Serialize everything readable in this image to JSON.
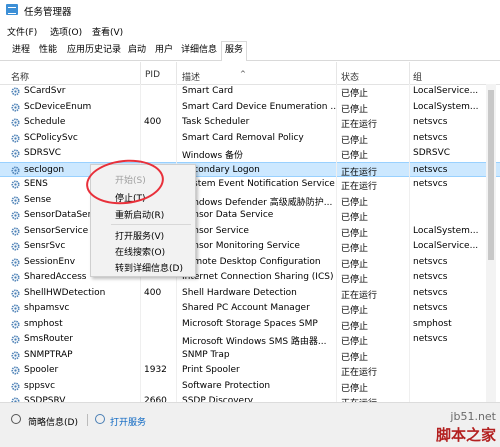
{
  "window": {
    "title": "任务管理器"
  },
  "menu": [
    "文件(F)",
    "选项(O)",
    "查看(V)"
  ],
  "tabs": [
    "进程",
    "性能",
    "应用历史记录",
    "启动",
    "用户",
    "详细信息",
    "服务"
  ],
  "active_tab": "服务",
  "columns": {
    "name": "名称",
    "pid": "PID",
    "desc": "描述",
    "status": "状态",
    "group": "组"
  },
  "services": [
    {
      "name": "SCardSvr",
      "pid": "",
      "desc": "Smart Card",
      "status": "已停止",
      "group": "LocalService..."
    },
    {
      "name": "ScDeviceEnum",
      "pid": "",
      "desc": "Smart Card Device Enumeration ...",
      "status": "已停止",
      "group": "LocalSystem..."
    },
    {
      "name": "Schedule",
      "pid": "400",
      "desc": "Task Scheduler",
      "status": "正在运行",
      "group": "netsvcs"
    },
    {
      "name": "SCPolicySvc",
      "pid": "",
      "desc": "Smart Card Removal Policy",
      "status": "已停止",
      "group": "netsvcs"
    },
    {
      "name": "SDRSVC",
      "pid": "",
      "desc": "Windows 备份",
      "status": "已停止",
      "group": "SDRSVC"
    },
    {
      "name": "seclogon",
      "pid": "",
      "desc": "Secondary Logon",
      "status": "正在运行",
      "group": "netsvcs"
    },
    {
      "name": "SENS",
      "pid": "",
      "desc": "System Event Notification Service",
      "status": "正在运行",
      "group": "netsvcs"
    },
    {
      "name": "Sense",
      "pid": "",
      "desc": "Windows Defender 高级威胁防护...",
      "status": "已停止",
      "group": ""
    },
    {
      "name": "SensorDataService",
      "pid": "",
      "desc": "Sensor Data Service",
      "status": "已停止",
      "group": ""
    },
    {
      "name": "SensorService",
      "pid": "",
      "desc": "Sensor Service",
      "status": "已停止",
      "group": "LocalSystem..."
    },
    {
      "name": "SensrSvc",
      "pid": "",
      "desc": "Sensor Monitoring Service",
      "status": "已停止",
      "group": "LocalService..."
    },
    {
      "name": "SessionEnv",
      "pid": "",
      "desc": "Remote Desktop Configuration",
      "status": "已停止",
      "group": "netsvcs"
    },
    {
      "name": "SharedAccess",
      "pid": "",
      "desc": "Internet Connection Sharing (ICS)",
      "status": "已停止",
      "group": "netsvcs"
    },
    {
      "name": "ShellHWDetection",
      "pid": "400",
      "desc": "Shell Hardware Detection",
      "status": "正在运行",
      "group": "netsvcs"
    },
    {
      "name": "shpamsvc",
      "pid": "",
      "desc": "Shared PC Account Manager",
      "status": "已停止",
      "group": "netsvcs"
    },
    {
      "name": "smphost",
      "pid": "",
      "desc": "Microsoft Storage Spaces SMP",
      "status": "已停止",
      "group": "smphost"
    },
    {
      "name": "SmsRouter",
      "pid": "",
      "desc": "Microsoft Windows SMS 路由器...",
      "status": "已停止",
      "group": "netsvcs"
    },
    {
      "name": "SNMPTRAP",
      "pid": "",
      "desc": "SNMP Trap",
      "status": "已停止",
      "group": ""
    },
    {
      "name": "Spooler",
      "pid": "1932",
      "desc": "Print Spooler",
      "status": "正在运行",
      "group": ""
    },
    {
      "name": "sppsvc",
      "pid": "",
      "desc": "Software Protection",
      "status": "已停止",
      "group": ""
    },
    {
      "name": "SSDPSRV",
      "pid": "2660",
      "desc": "SSDP Discovery",
      "status": "正在运行",
      "group": ""
    }
  ],
  "selected_service": "seclogon",
  "context_menu": [
    {
      "label": "开始(S)",
      "enabled": false
    },
    {
      "label": "停止(T)",
      "enabled": true
    },
    {
      "label": "重新启动(R)",
      "enabled": true
    },
    {
      "label": "打开服务(V)",
      "enabled": true
    },
    {
      "label": "在线搜索(O)",
      "enabled": true
    },
    {
      "label": "转到详细信息(D)",
      "enabled": true
    }
  ],
  "footer": {
    "brief_label": "简略信息(D)",
    "open_services_label": "打开服务"
  },
  "watermark": {
    "line1": "jb51.net",
    "line2": "脚本之家"
  },
  "colors": {
    "selected_row": "#cce8ff",
    "accent": "#0b66c2",
    "annotation": "#e8303a",
    "gear": "#4a7fb5"
  }
}
